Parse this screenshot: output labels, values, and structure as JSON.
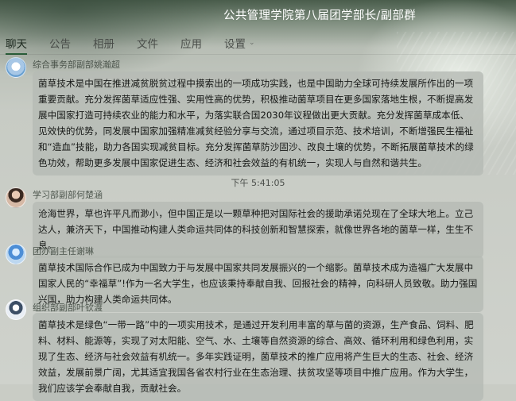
{
  "header": {
    "group_title": "公共管理学院第八届团学部长/副部群"
  },
  "tabs": [
    {
      "label": "聊天"
    },
    {
      "label": "公告"
    },
    {
      "label": "相册"
    },
    {
      "label": "文件"
    },
    {
      "label": "应用"
    },
    {
      "label": "设置"
    }
  ],
  "messages": [
    {
      "sender": "综合事务部副部姚瀚超",
      "text": "菌草技术是中国在推进减贫脱贫过程中摸索出的一项成功实践，也是中国助力全球可持续发展所作出的一项重要贡献。充分发挥菌草适应性强、实用性高的优势，积极推动菌草项目在更多国家落地生根，不断提高发展中国家打造可持续农业的能力和水平，为落实联合国2030年议程做出更大贡献。充分发挥菌草成本低、见效快的优势，同发展中国家加强精准减贫经验分享与交流，通过项目示范、技术培训，不断增强民生福祉和“造血”技能，助力各国实现减贫目标。充分发挥菌草防沙固沙、改良土壤的优势，不断拓展菌草技术的绿色功效，帮助更多发展中国家促进生态、经济和社会效益的有机统一，实现人与自然和谐共生。"
    },
    {
      "time": "下午 5:41:05",
      "sender": "学习部副部何楚涵",
      "text": "沧海世界，草也许平凡而渺小，但中国正是以一颗草种把对国际社会的援助承诺兑现在了全球大地上。立己达人，兼济天下，中国推动构建人类命运共同体的科技创新和智慧探索，就像世界各地的菌草一样，生生不息。"
    },
    {
      "sender": "团办副主任谢琳",
      "text": "菌草技术国际合作已成为中国致力于与发展中国家共同发展振兴的一个缩影。菌草技术成为造福广大发展中国家人民的“幸福草”!作为一名大学生，也应该秉持奉献自我、回报社会的精神，向科研人员致敬。助力强国兴国，助力构建人类命运共同体。"
    },
    {
      "sender": "组织部副部叶钦渡",
      "text": "菌草技术是绿色“一带一路”中的一项实用技术，是通过开发利用丰富的草与菌的资源，生产食品、饲料、肥料、材料、能源等，实现了对太阳能、空气、水、土壤等自然资源的综合、高效、循环利用和绿色利用，实现了生态、经济与社会效益有机统一。多年实践证明，菌草技术的推广应用将产生巨大的生态、社会、经济效益，发展前景广阔，尤其适宜我国各省农村行业在生态治理、扶贫攻坚等项目中推广应用。作为大学生，我们应该学会奉献自我，贡献社会。"
    }
  ]
}
